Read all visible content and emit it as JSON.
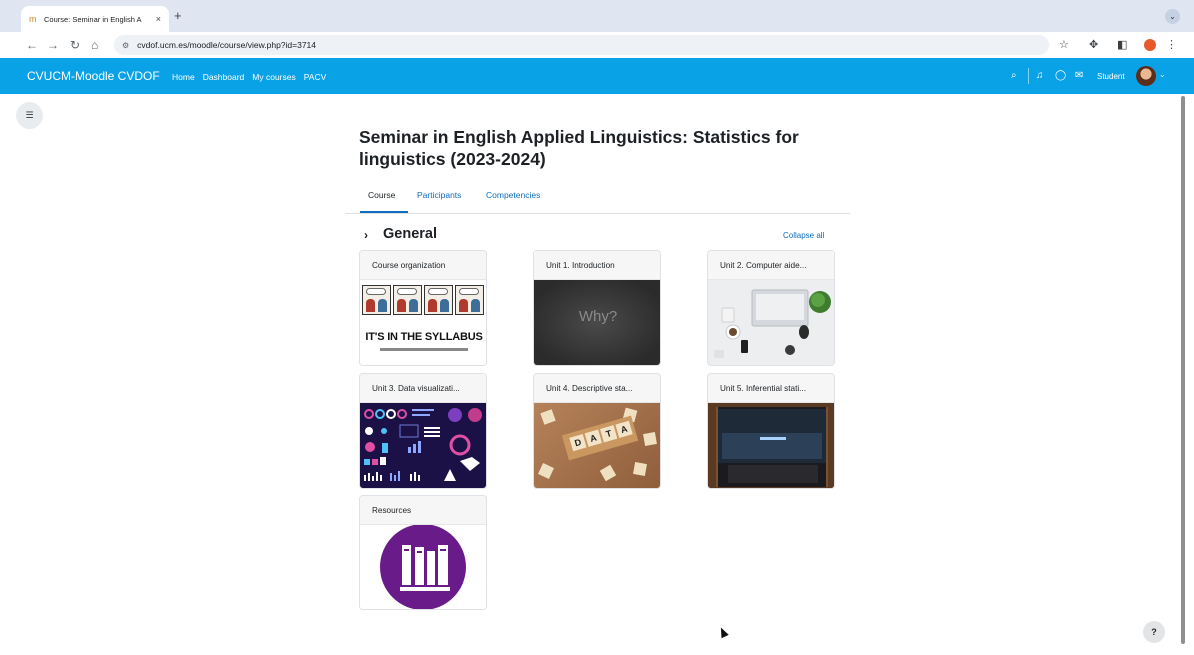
{
  "browser": {
    "tab_title": "Course: Seminar in English A",
    "tab_close": "×",
    "new_tab": "+",
    "url": "cvdof.ucm.es/moodle/course/view.php?id=3714"
  },
  "navbar": {
    "brand": "CVUCM-Moodle CVDOF",
    "links": [
      "Home",
      "Dashboard",
      "My courses",
      "PACV"
    ],
    "user_label": "Student"
  },
  "course": {
    "title": "Seminar in English Applied Linguistics: Statistics for linguistics (2023-2024)",
    "tabs": [
      "Course",
      "Participants",
      "Competencies"
    ],
    "section_title": "General",
    "collapse_all": "Collapse all",
    "cards": [
      "Course organization",
      "Unit 1. Introduction",
      "Unit 2. Computer aide...",
      "Unit 3. Data visualizati...",
      "Unit 4. Descriptive sta...",
      "Unit 5. Inferential stati...",
      "Resources"
    ],
    "thumb_text": {
      "syllabus": "IT'S IN THE SYLLABUS",
      "why": "Why?",
      "scrabble": [
        "D",
        "A",
        "T",
        "A"
      ]
    }
  },
  "help": "?",
  "colors": {
    "navbar": "#0aa2e6",
    "link": "#0f6cbf",
    "resources_purple": "#6a1b8a"
  }
}
